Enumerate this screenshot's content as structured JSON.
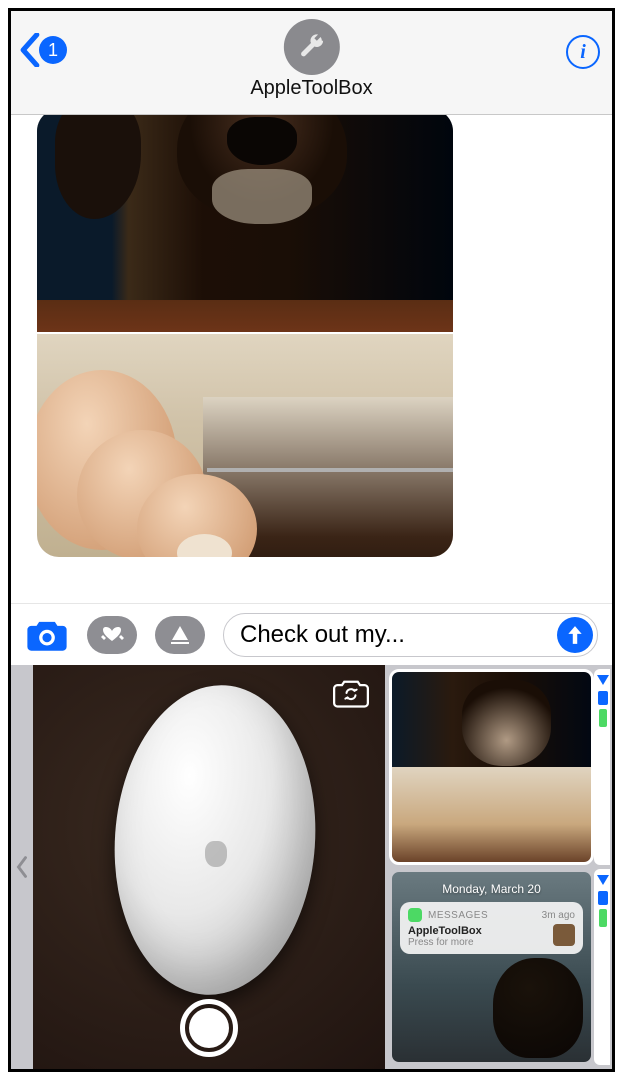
{
  "header": {
    "back_count": "1",
    "contact_name": "AppleToolBox",
    "info_label": "i"
  },
  "compose": {
    "text": "Check out my..."
  },
  "recent_screenshot": {
    "date": "Monday, March 20",
    "notif_app": "MESSAGES",
    "notif_time": "3m ago",
    "notif_title": "AppleToolBox",
    "notif_sub": "Press for more"
  },
  "icons": {
    "back": "chevron-left",
    "info": "info",
    "avatar": "wrench",
    "camera": "camera",
    "digital_touch": "heart-fingers",
    "app_store": "app-store",
    "send": "arrow-up",
    "switch_camera": "camera-rotate",
    "shutter": "shutter",
    "drawer_back": "chevron-left"
  }
}
